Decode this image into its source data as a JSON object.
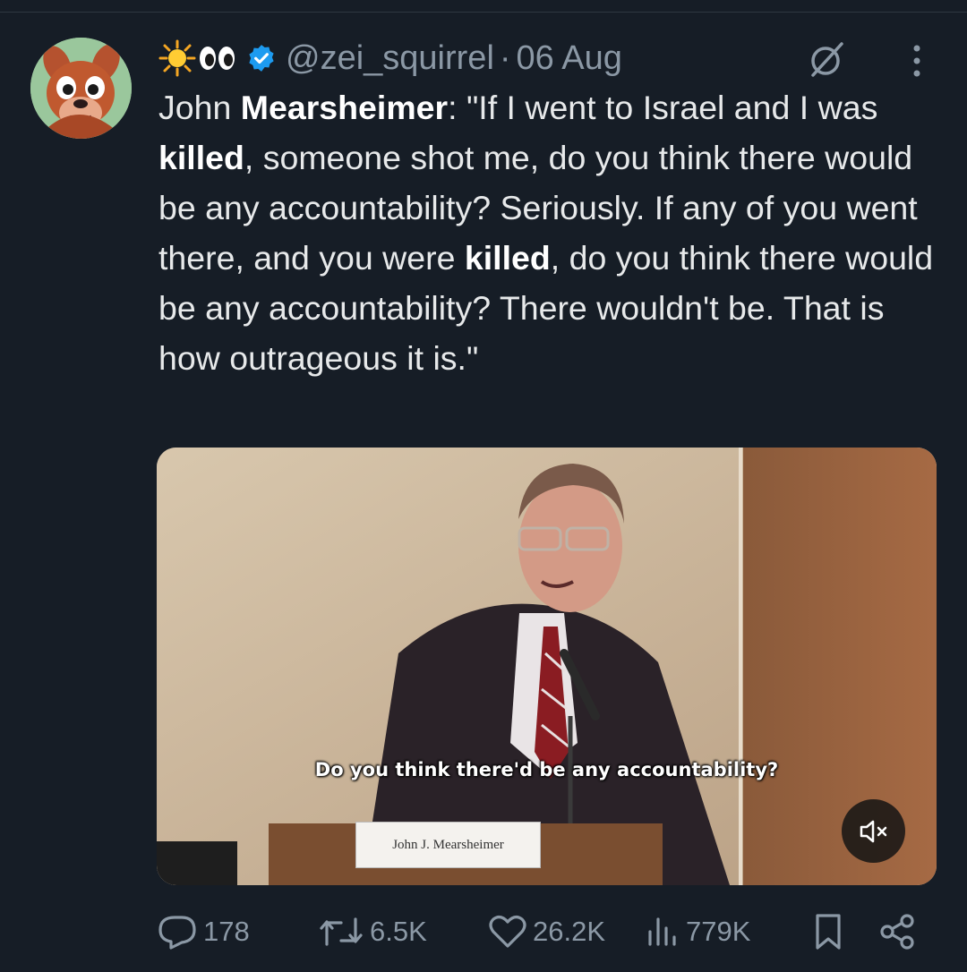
{
  "tweet": {
    "author": {
      "display_emojis": [
        "sun-emoji",
        "eyes-emoji"
      ],
      "verified": true,
      "handle": "@zei_squirrel",
      "separator": "·",
      "date": "06 Aug"
    },
    "text": {
      "t1": "John ",
      "b1": "Mearsheimer",
      "t2": ": \"If I went to Israel and I was ",
      "b2": "killed",
      "t3": ", someone shot me, do you think there would be any accountability? Seriously. If any of you went there, and you were ",
      "b3": "killed",
      "t4": ", do you think there would be any accountability? There wouldn't be. That is how outrageous it is.\""
    },
    "media": {
      "caption": "Do you think there'd be any accountability?",
      "nameplate": "John J. Mearsheimer",
      "muted": true
    },
    "stats": {
      "replies": "178",
      "reposts": "6.5K",
      "likes": "26.2K",
      "views": "779K"
    }
  },
  "colors": {
    "background": "#161d26",
    "text": "#e7e9ea",
    "muted": "#8b98a5",
    "verified": "#1d9bf0"
  }
}
